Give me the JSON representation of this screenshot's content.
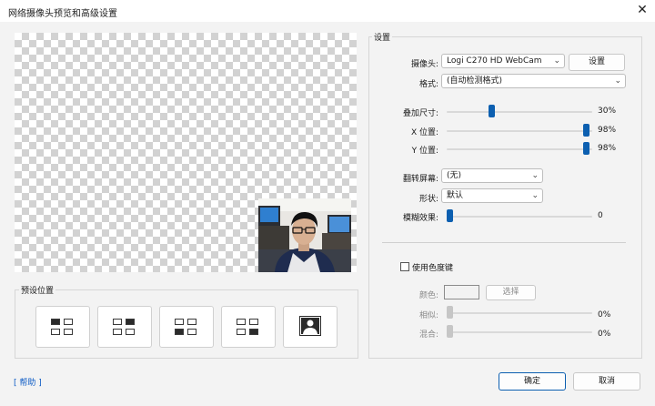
{
  "window": {
    "title": "网络摄像头预览和高级设置",
    "close_glyph": "✕"
  },
  "presets": {
    "legend": "预设位置",
    "buttons": [
      {
        "name": "preset-top-left"
      },
      {
        "name": "preset-top-right"
      },
      {
        "name": "preset-bottom-left"
      },
      {
        "name": "preset-bottom-right"
      },
      {
        "name": "preset-fullscreen"
      }
    ]
  },
  "settings": {
    "legend": "设置",
    "camera": {
      "label": "摄像头:",
      "value": "Logi C270 HD WebCam",
      "settings_button": "设置"
    },
    "format": {
      "label": "格式:",
      "value": "(自动检测格式)"
    },
    "overlay_size": {
      "label": "叠加尺寸:",
      "value": "30%",
      "level": 0.3
    },
    "x_position": {
      "label": "X 位置:",
      "value": "98%",
      "level": 0.98
    },
    "y_position": {
      "label": "Y 位置:",
      "value": "98%",
      "level": 0.98
    },
    "flip": {
      "label": "翻转屏幕:",
      "value": "(无)"
    },
    "shape": {
      "label": "形状:",
      "value": "默认"
    },
    "blur": {
      "label": "模糊效果:",
      "value": "0",
      "level": 0.0
    },
    "chroma": {
      "checkbox_label": "使用色度键",
      "checked": false,
      "color_label": "颜色:",
      "choose_button": "选择",
      "similarity": {
        "label": "相似:",
        "value": "0%",
        "level": 0.0
      },
      "blend": {
        "label": "混合:",
        "value": "0%",
        "level": 0.0
      }
    }
  },
  "footer": {
    "help": "[ 帮助 ]",
    "ok": "确定",
    "cancel": "取消"
  },
  "colors": {
    "accent": "#0c5fb0",
    "link": "#0b5ac4"
  },
  "icons": {
    "close": "close-icon",
    "dropdown": "chevron-down-icon",
    "fullscreen_preset": "person-portrait-icon"
  }
}
